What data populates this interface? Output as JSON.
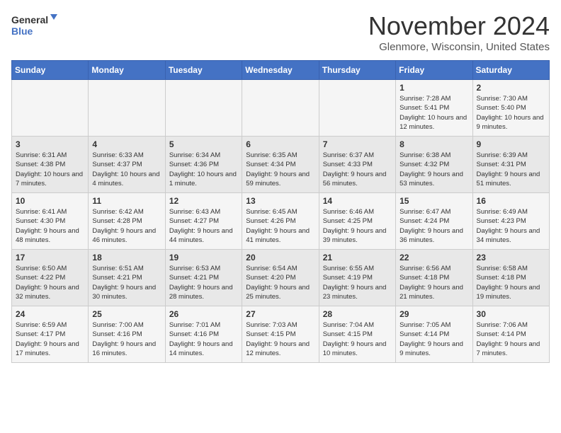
{
  "header": {
    "logo_line1": "General",
    "logo_line2": "Blue",
    "month_title": "November 2024",
    "location": "Glenmore, Wisconsin, United States"
  },
  "days_of_week": [
    "Sunday",
    "Monday",
    "Tuesday",
    "Wednesday",
    "Thursday",
    "Friday",
    "Saturday"
  ],
  "weeks": [
    [
      {
        "day": "",
        "info": ""
      },
      {
        "day": "",
        "info": ""
      },
      {
        "day": "",
        "info": ""
      },
      {
        "day": "",
        "info": ""
      },
      {
        "day": "",
        "info": ""
      },
      {
        "day": "1",
        "info": "Sunrise: 7:28 AM\nSunset: 5:41 PM\nDaylight: 10 hours and 12 minutes."
      },
      {
        "day": "2",
        "info": "Sunrise: 7:30 AM\nSunset: 5:40 PM\nDaylight: 10 hours and 9 minutes."
      }
    ],
    [
      {
        "day": "3",
        "info": "Sunrise: 6:31 AM\nSunset: 4:38 PM\nDaylight: 10 hours and 7 minutes."
      },
      {
        "day": "4",
        "info": "Sunrise: 6:33 AM\nSunset: 4:37 PM\nDaylight: 10 hours and 4 minutes."
      },
      {
        "day": "5",
        "info": "Sunrise: 6:34 AM\nSunset: 4:36 PM\nDaylight: 10 hours and 1 minute."
      },
      {
        "day": "6",
        "info": "Sunrise: 6:35 AM\nSunset: 4:34 PM\nDaylight: 9 hours and 59 minutes."
      },
      {
        "day": "7",
        "info": "Sunrise: 6:37 AM\nSunset: 4:33 PM\nDaylight: 9 hours and 56 minutes."
      },
      {
        "day": "8",
        "info": "Sunrise: 6:38 AM\nSunset: 4:32 PM\nDaylight: 9 hours and 53 minutes."
      },
      {
        "day": "9",
        "info": "Sunrise: 6:39 AM\nSunset: 4:31 PM\nDaylight: 9 hours and 51 minutes."
      }
    ],
    [
      {
        "day": "10",
        "info": "Sunrise: 6:41 AM\nSunset: 4:30 PM\nDaylight: 9 hours and 48 minutes."
      },
      {
        "day": "11",
        "info": "Sunrise: 6:42 AM\nSunset: 4:28 PM\nDaylight: 9 hours and 46 minutes."
      },
      {
        "day": "12",
        "info": "Sunrise: 6:43 AM\nSunset: 4:27 PM\nDaylight: 9 hours and 44 minutes."
      },
      {
        "day": "13",
        "info": "Sunrise: 6:45 AM\nSunset: 4:26 PM\nDaylight: 9 hours and 41 minutes."
      },
      {
        "day": "14",
        "info": "Sunrise: 6:46 AM\nSunset: 4:25 PM\nDaylight: 9 hours and 39 minutes."
      },
      {
        "day": "15",
        "info": "Sunrise: 6:47 AM\nSunset: 4:24 PM\nDaylight: 9 hours and 36 minutes."
      },
      {
        "day": "16",
        "info": "Sunrise: 6:49 AM\nSunset: 4:23 PM\nDaylight: 9 hours and 34 minutes."
      }
    ],
    [
      {
        "day": "17",
        "info": "Sunrise: 6:50 AM\nSunset: 4:22 PM\nDaylight: 9 hours and 32 minutes."
      },
      {
        "day": "18",
        "info": "Sunrise: 6:51 AM\nSunset: 4:21 PM\nDaylight: 9 hours and 30 minutes."
      },
      {
        "day": "19",
        "info": "Sunrise: 6:53 AM\nSunset: 4:21 PM\nDaylight: 9 hours and 28 minutes."
      },
      {
        "day": "20",
        "info": "Sunrise: 6:54 AM\nSunset: 4:20 PM\nDaylight: 9 hours and 25 minutes."
      },
      {
        "day": "21",
        "info": "Sunrise: 6:55 AM\nSunset: 4:19 PM\nDaylight: 9 hours and 23 minutes."
      },
      {
        "day": "22",
        "info": "Sunrise: 6:56 AM\nSunset: 4:18 PM\nDaylight: 9 hours and 21 minutes."
      },
      {
        "day": "23",
        "info": "Sunrise: 6:58 AM\nSunset: 4:18 PM\nDaylight: 9 hours and 19 minutes."
      }
    ],
    [
      {
        "day": "24",
        "info": "Sunrise: 6:59 AM\nSunset: 4:17 PM\nDaylight: 9 hours and 17 minutes."
      },
      {
        "day": "25",
        "info": "Sunrise: 7:00 AM\nSunset: 4:16 PM\nDaylight: 9 hours and 16 minutes."
      },
      {
        "day": "26",
        "info": "Sunrise: 7:01 AM\nSunset: 4:16 PM\nDaylight: 9 hours and 14 minutes."
      },
      {
        "day": "27",
        "info": "Sunrise: 7:03 AM\nSunset: 4:15 PM\nDaylight: 9 hours and 12 minutes."
      },
      {
        "day": "28",
        "info": "Sunrise: 7:04 AM\nSunset: 4:15 PM\nDaylight: 9 hours and 10 minutes."
      },
      {
        "day": "29",
        "info": "Sunrise: 7:05 AM\nSunset: 4:14 PM\nDaylight: 9 hours and 9 minutes."
      },
      {
        "day": "30",
        "info": "Sunrise: 7:06 AM\nSunset: 4:14 PM\nDaylight: 9 hours and 7 minutes."
      }
    ]
  ]
}
